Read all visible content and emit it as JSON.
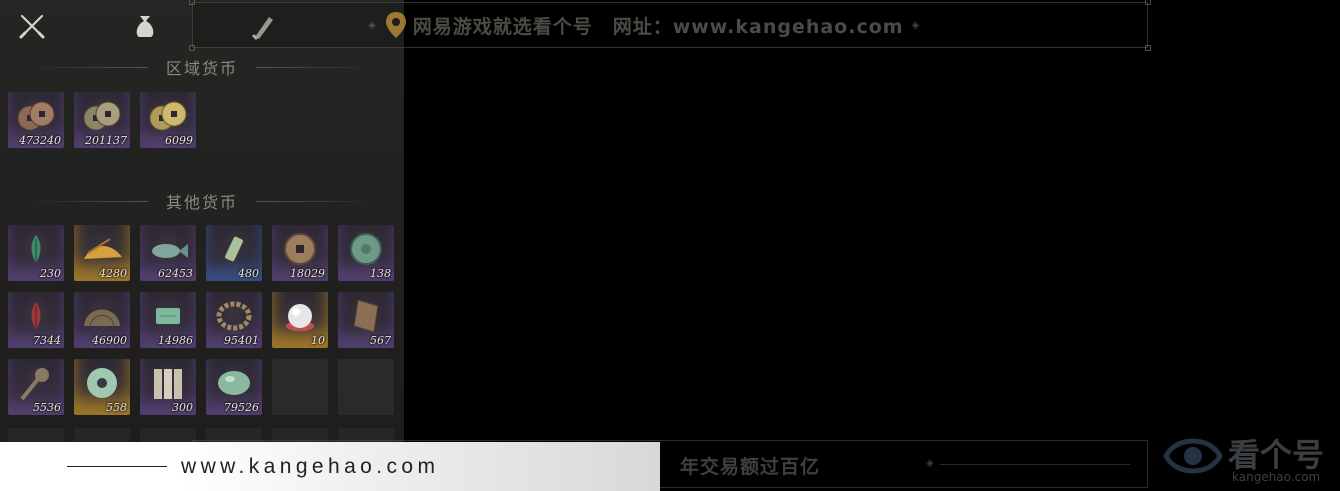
{
  "tabs": [
    {
      "icon": "crossed-swords-icon"
    },
    {
      "icon": "money-pouch-icon"
    },
    {
      "icon": "scroll-icon"
    }
  ],
  "sections": {
    "regional": {
      "title": "区域货币"
    },
    "other": {
      "title": "其他货币"
    }
  },
  "regional_currency": [
    {
      "qty": "473240",
      "icon": "copper-coins-icon"
    },
    {
      "qty": "201137",
      "icon": "silver-coins-icon"
    },
    {
      "qty": "6099",
      "icon": "gold-coins-icon"
    }
  ],
  "other_currency": [
    {
      "qty": "230",
      "icon": "green-feather-icon"
    },
    {
      "qty": "4280",
      "icon": "grain-pile-icon"
    },
    {
      "qty": "62453",
      "icon": "jade-fish-icon"
    },
    {
      "qty": "480",
      "icon": "jade-token-icon"
    },
    {
      "qty": "18029",
      "icon": "ancient-coin-icon"
    },
    {
      "qty": "138",
      "icon": "jade-disc-icon"
    },
    {
      "qty": "7344",
      "icon": "red-feather-icon"
    },
    {
      "qty": "46900",
      "icon": "bronze-mirror-icon"
    },
    {
      "qty": "14986",
      "icon": "jade-ticket-icon"
    },
    {
      "qty": "95401",
      "icon": "prayer-beads-icon"
    },
    {
      "qty": "10",
      "icon": "pearl-icon"
    },
    {
      "qty": "567",
      "icon": "bronze-plaque-icon"
    },
    {
      "qty": "5536",
      "icon": "coin-sword-icon"
    },
    {
      "qty": "558",
      "icon": "jade-ring-icon"
    },
    {
      "qty": "300",
      "icon": "bamboo-slips-icon"
    },
    {
      "qty": "79526",
      "icon": "jade-stone-icon"
    }
  ],
  "watermark": {
    "top_text": "网易游戏就选看个号　网址：www.kangehao.com",
    "bottom_text": "看个号专业网易游戏八年　年交易额过百亿",
    "url": "www.kangehao.com",
    "logo_name": "看个号",
    "logo_site": "kangehao.com"
  },
  "colors": {
    "panel": "#252523",
    "slot_purple": "#7a5aa8",
    "slot_blue": "#466ebe",
    "slot_gold": "#c8962a"
  }
}
